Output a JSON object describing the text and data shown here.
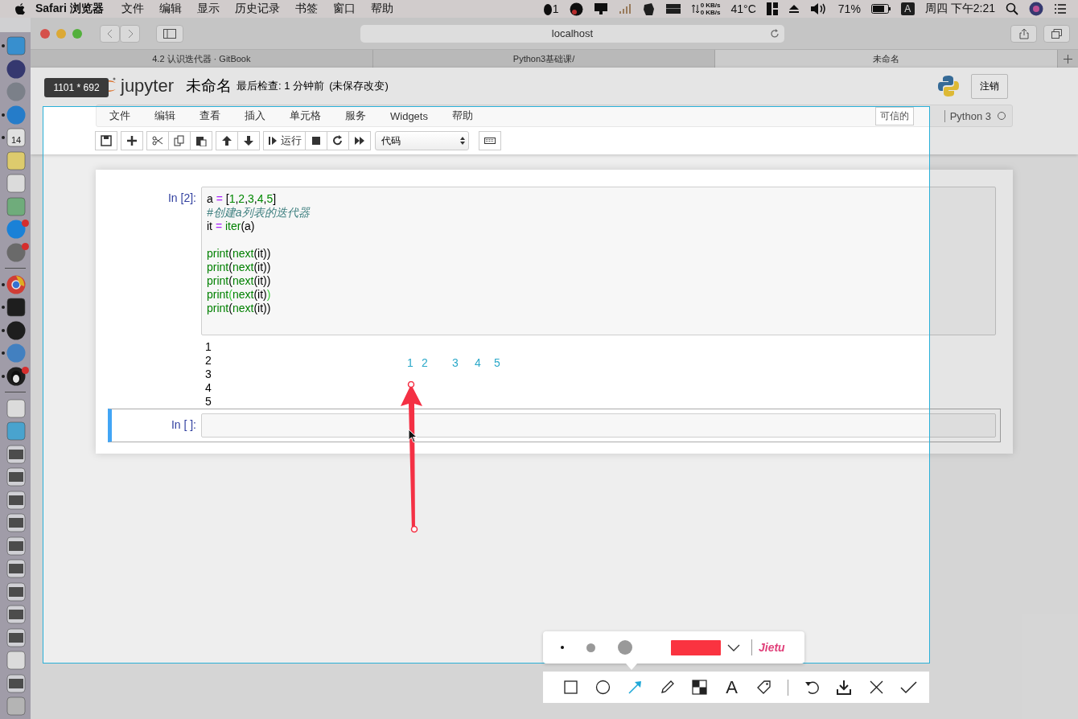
{
  "menu_bar": {
    "app": "Safari 浏览器",
    "items": [
      "文件",
      "编辑",
      "显示",
      "历史记录",
      "书签",
      "窗口",
      "帮助"
    ],
    "status": {
      "qq_badge": "1",
      "net_up": "0 KB/s",
      "net_down": "0 KB/s",
      "temperature": "41°C",
      "battery": "71%",
      "input_source": "A",
      "clock": "周四 下午2:21"
    }
  },
  "dock": {
    "sections": [
      {
        "apps": [
          {
            "kind": "finder",
            "running": true,
            "badge": false
          },
          {
            "kind": "siri",
            "running": false,
            "badge": false
          },
          {
            "kind": "launchpad",
            "running": false,
            "badge": false
          },
          {
            "kind": "safari",
            "running": true,
            "badge": false
          },
          {
            "kind": "calendar",
            "running": true,
            "badge": false,
            "label": "14"
          },
          {
            "kind": "notes",
            "running": false,
            "badge": false
          },
          {
            "kind": "reminders",
            "running": false,
            "badge": false
          },
          {
            "kind": "maps",
            "running": false,
            "badge": false
          },
          {
            "kind": "appstore",
            "running": false,
            "badge": true
          },
          {
            "kind": "preferences",
            "running": false,
            "badge": true
          }
        ]
      },
      {
        "apps": [
          {
            "kind": "chrome",
            "running": true,
            "badge": false
          },
          {
            "kind": "terminal",
            "running": true,
            "badge": false
          },
          {
            "kind": "obs",
            "running": true,
            "badge": false
          },
          {
            "kind": "books",
            "running": true,
            "badge": false
          },
          {
            "kind": "qq",
            "running": true,
            "badge": true
          }
        ]
      },
      {
        "apps": [
          {
            "kind": "document",
            "running": false,
            "badge": false
          },
          {
            "kind": "folder",
            "running": false,
            "badge": false
          },
          {
            "kind": "window",
            "running": false,
            "badge": false
          },
          {
            "kind": "window",
            "running": false,
            "badge": false
          },
          {
            "kind": "window",
            "running": false,
            "badge": false
          },
          {
            "kind": "window",
            "running": false,
            "badge": false
          },
          {
            "kind": "window",
            "running": false,
            "badge": false
          },
          {
            "kind": "window",
            "running": false,
            "badge": false
          },
          {
            "kind": "window",
            "running": false,
            "badge": false
          },
          {
            "kind": "window",
            "running": false,
            "badge": false
          },
          {
            "kind": "window",
            "running": false,
            "badge": false
          },
          {
            "kind": "document",
            "running": false,
            "badge": false
          },
          {
            "kind": "window",
            "running": false,
            "badge": false
          },
          {
            "kind": "trash",
            "running": false,
            "badge": false
          }
        ]
      }
    ]
  },
  "browser": {
    "address": "localhost",
    "tabs": [
      {
        "label": "4.2 认识迭代器 · GitBook",
        "selected": false
      },
      {
        "label": "Python3基础课/",
        "selected": false
      },
      {
        "label": "未命名",
        "selected": true
      }
    ]
  },
  "jupyter": {
    "logo": "jupyter",
    "notebook_name": "未命名",
    "checkpoint": "最后检查: 1 分钟前",
    "unsaved": "(未保存改变)",
    "logout": "注销",
    "menu": [
      "文件",
      "编辑",
      "查看",
      "插入",
      "单元格",
      "服务",
      "Widgets",
      "帮助"
    ],
    "trusted": "可信的",
    "kernel": "Python 3",
    "run_label": "运行",
    "cell_type": "代码",
    "cells": [
      {
        "prompt": "In [2]:",
        "selected": false,
        "lines": [
          {
            "kind": "code",
            "tokens": [
              {
                "text": "a ",
                "kind": "plain"
              },
              {
                "text": "=",
                "kind": "op"
              },
              {
                "text": " [",
                "kind": "plain"
              },
              {
                "text": "1",
                "kind": "num"
              },
              {
                "text": ",",
                "kind": "plain"
              },
              {
                "text": "2",
                "kind": "num"
              },
              {
                "text": ",",
                "kind": "plain"
              },
              {
                "text": "3",
                "kind": "num"
              },
              {
                "text": ",",
                "kind": "plain"
              },
              {
                "text": "4",
                "kind": "num"
              },
              {
                "text": ",",
                "kind": "plain"
              },
              {
                "text": "5",
                "kind": "num"
              },
              {
                "text": "]",
                "kind": "plain"
              }
            ]
          },
          {
            "kind": "code",
            "tokens": [
              {
                "text": "#创建a列表的迭代器",
                "kind": "comment"
              }
            ]
          },
          {
            "kind": "code",
            "tokens": [
              {
                "text": "it ",
                "kind": "plain"
              },
              {
                "text": "= ",
                "kind": "op"
              },
              {
                "text": "iter",
                "kind": "builtin"
              },
              {
                "text": "(a)",
                "kind": "plain"
              }
            ]
          },
          {
            "kind": "blank"
          },
          {
            "kind": "code",
            "tokens": [
              {
                "text": "print",
                "kind": "builtin"
              },
              {
                "text": "(",
                "kind": "plain"
              },
              {
                "text": "next",
                "kind": "builtin"
              },
              {
                "text": "(it))",
                "kind": "plain"
              }
            ]
          },
          {
            "kind": "code",
            "tokens": [
              {
                "text": "print",
                "kind": "builtin"
              },
              {
                "text": "(",
                "kind": "plain"
              },
              {
                "text": "next",
                "kind": "builtin"
              },
              {
                "text": "(it))",
                "kind": "plain"
              }
            ]
          },
          {
            "kind": "code",
            "tokens": [
              {
                "text": "print",
                "kind": "builtin"
              },
              {
                "text": "(",
                "kind": "plain"
              },
              {
                "text": "next",
                "kind": "builtin"
              },
              {
                "text": "(it))",
                "kind": "plain"
              }
            ]
          },
          {
            "kind": "code",
            "tokens": [
              {
                "text": "print",
                "kind": "builtin"
              },
              {
                "text": "(",
                "kind": "match"
              },
              {
                "text": "next",
                "kind": "builtin"
              },
              {
                "text": "(it)",
                "kind": "plain"
              },
              {
                "text": ")",
                "kind": "match"
              }
            ]
          },
          {
            "kind": "code",
            "tokens": [
              {
                "text": "print",
                "kind": "builtin"
              },
              {
                "text": "(",
                "kind": "plain"
              },
              {
                "text": "next",
                "kind": "builtin"
              },
              {
                "text": "(it))",
                "kind": "plain"
              }
            ]
          }
        ],
        "output": [
          "1",
          "2",
          "3",
          "4",
          "5"
        ]
      },
      {
        "prompt": "In [ ]:",
        "selected": true
      }
    ]
  },
  "screenshot_tool": {
    "size_label": "1101 * 692",
    "numbers": [
      "1",
      "2",
      "3",
      "4",
      "5"
    ],
    "pen_sizes": [
      {
        "selected": true
      },
      {
        "selected": false
      },
      {
        "selected": false
      }
    ],
    "pen": {
      "color": "#fa3340"
    },
    "brand": "Jietu",
    "tools": [
      {
        "kind": "rect",
        "selected": false
      },
      {
        "kind": "ellipse",
        "selected": false
      },
      {
        "kind": "arrow",
        "selected": true
      },
      {
        "kind": "pencil",
        "selected": false
      },
      {
        "kind": "mosaic",
        "selected": false
      },
      {
        "kind": "text",
        "glyph": "A",
        "selected": false
      },
      {
        "kind": "tag",
        "selected": false
      }
    ],
    "actions": [
      {
        "kind": "undo"
      },
      {
        "kind": "download"
      },
      {
        "kind": "close"
      },
      {
        "kind": "confirm"
      }
    ]
  }
}
